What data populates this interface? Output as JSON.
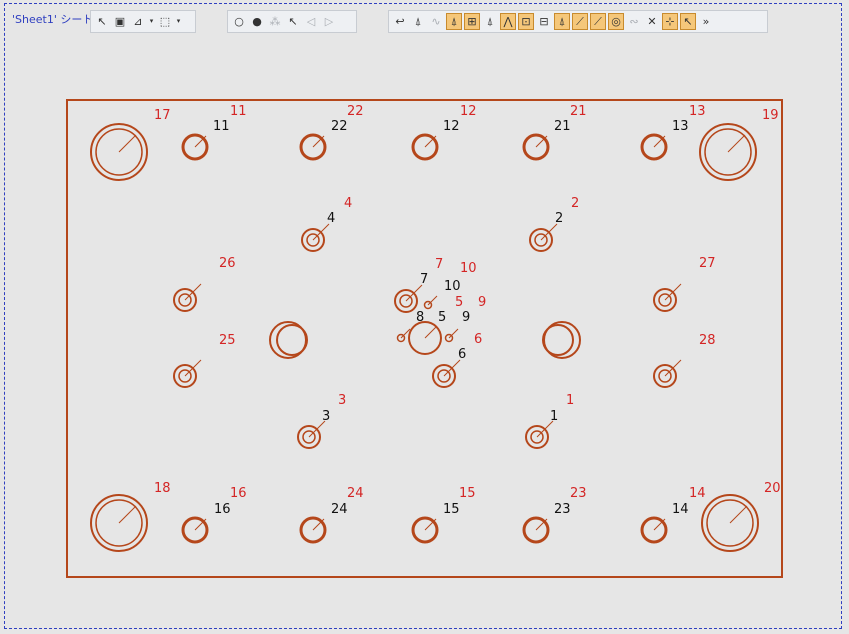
{
  "sheet": {
    "tab_label": "'Sheet1' シート"
  },
  "colors": {
    "geometry": "#b5471b",
    "label_red": "#d42525",
    "label_black": "#111111",
    "sheet_border": "#2f3fc0"
  },
  "toolbar_left": [
    {
      "icon": "select-delete-icon",
      "glyph": "↖",
      "state": "normal"
    },
    {
      "icon": "select-box-icon",
      "glyph": "▣",
      "state": "normal"
    },
    {
      "icon": "filter-select-icon",
      "glyph": "⊿",
      "state": "normal"
    },
    {
      "icon": "dropdown-arrow-icon",
      "glyph": "▾",
      "state": "drop"
    },
    {
      "icon": "window-select-icon",
      "glyph": "⬚",
      "state": "normal"
    },
    {
      "icon": "dropdown-arrow-icon",
      "glyph": "▾",
      "state": "drop"
    }
  ],
  "toolbar_mid": [
    {
      "icon": "lightbulb-off-icon",
      "glyph": "○",
      "state": "normal"
    },
    {
      "icon": "lightbulb-on-icon",
      "glyph": "●",
      "state": "normal"
    },
    {
      "icon": "toggle-display-icon",
      "glyph": "⁂",
      "state": "dim"
    },
    {
      "icon": "pointer-pick-icon",
      "glyph": "↖",
      "state": "normal"
    },
    {
      "icon": "back-arrow-icon",
      "glyph": "◁",
      "state": "dim"
    },
    {
      "icon": "forward-arrow-icon",
      "glyph": "▷",
      "state": "dim"
    }
  ],
  "toolbar_right": [
    {
      "icon": "undo-return-icon",
      "glyph": "↩",
      "state": "normal"
    },
    {
      "icon": "filter-icon",
      "glyph": "⍋",
      "state": "normal"
    },
    {
      "icon": "curve-filter-icon",
      "glyph": "∿",
      "state": "dim"
    },
    {
      "icon": "edge-filter-icon",
      "glyph": "⍋",
      "state": "on"
    },
    {
      "icon": "dimension-filter-icon",
      "glyph": "⊞",
      "state": "on"
    },
    {
      "icon": "annotation-filter-icon",
      "glyph": "⍋",
      "state": "normal"
    },
    {
      "icon": "vertex-filter-icon",
      "glyph": "⋀",
      "state": "on"
    },
    {
      "icon": "group-filter-icon",
      "glyph": "⊡",
      "state": "on"
    },
    {
      "icon": "layer-filter-icon",
      "glyph": "⊟",
      "state": "normal"
    },
    {
      "icon": "snap-filter-icon",
      "glyph": "⍋",
      "state": "on"
    },
    {
      "icon": "end-point-icon",
      "glyph": "⟋",
      "state": "on"
    },
    {
      "icon": "mid-point-icon",
      "glyph": "⟋",
      "state": "on"
    },
    {
      "icon": "center-point-icon",
      "glyph": "◎",
      "state": "on"
    },
    {
      "icon": "tangent-icon",
      "glyph": "∾",
      "state": "dim"
    },
    {
      "icon": "intersection-icon",
      "glyph": "✕",
      "state": "normal"
    },
    {
      "icon": "axis-point-icon",
      "glyph": "⊹",
      "state": "on"
    },
    {
      "icon": "point-on-icon",
      "glyph": "↖",
      "state": "on"
    },
    {
      "icon": "more-tools-icon",
      "glyph": "»",
      "state": "normal"
    }
  ],
  "holes": [
    {
      "id": "17",
      "tag_red": "17",
      "tag_black": "",
      "type": "large"
    },
    {
      "id": "11",
      "tag_red": "11",
      "tag_black": "11",
      "type": "medium"
    },
    {
      "id": "22",
      "tag_red": "22",
      "tag_black": "22",
      "type": "medium"
    },
    {
      "id": "12",
      "tag_red": "12",
      "tag_black": "12",
      "type": "medium"
    },
    {
      "id": "21",
      "tag_red": "21",
      "tag_black": "21",
      "type": "medium"
    },
    {
      "id": "13",
      "tag_red": "13",
      "tag_black": "13",
      "type": "medium"
    },
    {
      "id": "19",
      "tag_red": "19",
      "tag_black": "",
      "type": "large"
    },
    {
      "id": "4",
      "tag_red": "4",
      "tag_black": "4",
      "type": "ring"
    },
    {
      "id": "2",
      "tag_red": "2",
      "tag_black": "2",
      "type": "ring"
    },
    {
      "id": "26",
      "tag_red": "26",
      "tag_black": "",
      "type": "ring"
    },
    {
      "id": "27",
      "tag_red": "27",
      "tag_black": "",
      "type": "ring"
    },
    {
      "id": "7",
      "tag_red": "7",
      "tag_black": "7",
      "type": "ring"
    },
    {
      "id": "10",
      "tag_red": "10",
      "tag_black": "10",
      "type": "tiny"
    },
    {
      "id": "5",
      "tag_red": "5",
      "tag_black": "5",
      "type": "center"
    },
    {
      "id": "9",
      "tag_red": "9",
      "tag_black": "9",
      "type": "tiny"
    },
    {
      "id": "8",
      "tag_red": "",
      "tag_black": "8",
      "type": "tiny"
    },
    {
      "id": "6",
      "tag_red": "6",
      "tag_black": "6",
      "type": "ring"
    },
    {
      "id": "25",
      "tag_red": "25",
      "tag_black": "",
      "type": "ring"
    },
    {
      "id": "28",
      "tag_red": "28",
      "tag_black": "",
      "type": "ring"
    },
    {
      "id": "3",
      "tag_red": "3",
      "tag_black": "3",
      "type": "ring"
    },
    {
      "id": "1",
      "tag_red": "1",
      "tag_black": "1",
      "type": "ring"
    },
    {
      "id": "18",
      "tag_red": "18",
      "tag_black": "",
      "type": "large"
    },
    {
      "id": "16",
      "tag_red": "16",
      "tag_black": "16",
      "type": "medium"
    },
    {
      "id": "24",
      "tag_red": "24",
      "tag_black": "24",
      "type": "medium"
    },
    {
      "id": "15",
      "tag_red": "15",
      "tag_black": "15",
      "type": "medium"
    },
    {
      "id": "23",
      "tag_red": "23",
      "tag_black": "23",
      "type": "medium"
    },
    {
      "id": "14",
      "tag_red": "14",
      "tag_black": "14",
      "type": "medium"
    },
    {
      "id": "20",
      "tag_red": "20",
      "tag_black": "",
      "type": "large"
    }
  ]
}
